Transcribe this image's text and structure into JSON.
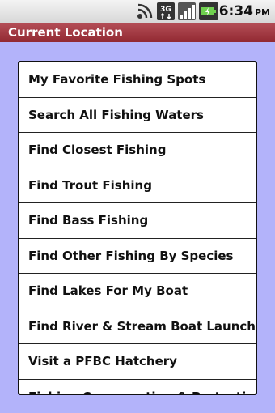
{
  "status_bar": {
    "time": "6:34",
    "ampm": "PM",
    "icons": [
      "signal-wifi-icon",
      "3g-icon",
      "cell-signal-icon",
      "battery-charging-icon"
    ]
  },
  "header": {
    "title": "Current Location"
  },
  "menu": {
    "items": [
      {
        "label": "My Favorite Fishing Spots"
      },
      {
        "label": "Search All Fishing Waters"
      },
      {
        "label": "Find Closest Fishing"
      },
      {
        "label": "Find Trout Fishing"
      },
      {
        "label": "Find Bass Fishing"
      },
      {
        "label": "Find Other Fishing By Species"
      },
      {
        "label": "Find Lakes For My Boat"
      },
      {
        "label": "Find River & Stream Boat Launches"
      },
      {
        "label": "Visit a PFBC Hatchery"
      },
      {
        "label": "Fishing Conservation & Protection"
      }
    ]
  },
  "colors": {
    "background": "#b3b3fa",
    "titlebar": "#a3363f",
    "list_bg": "#ffffff"
  }
}
